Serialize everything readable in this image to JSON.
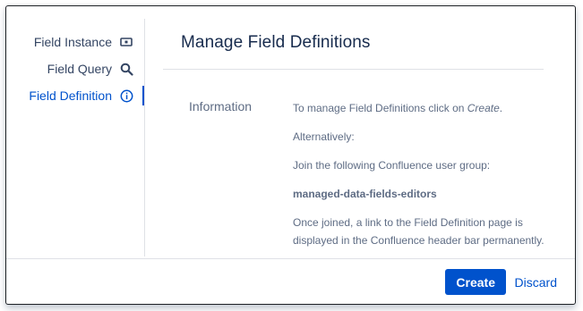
{
  "sidebar": {
    "items": [
      {
        "label": "Field Instance",
        "icon": "field-instance-icon",
        "active": false
      },
      {
        "label": "Field Query",
        "icon": "search-icon",
        "active": false
      },
      {
        "label": "Field Definition",
        "icon": "info-icon",
        "active": true
      }
    ]
  },
  "main": {
    "title": "Manage Field Definitions",
    "info_label": "Information",
    "info": {
      "line1_prefix": "To manage Field Definitions click on ",
      "line1_em": "Create",
      "line1_suffix": ".",
      "line2": "Alternatively:",
      "line3": "Join the following Confluence user group:",
      "group": "managed-data-fields-editors",
      "line5": "Once joined, a link to the Field Definition page is displayed in the Confluence header bar permanently."
    }
  },
  "footer": {
    "create_label": "Create",
    "discard_label": "Discard"
  },
  "colors": {
    "accent": "#0052cc",
    "text": "#172b4d",
    "subtle": "#5e6c84",
    "border": "#dfe1e6"
  }
}
